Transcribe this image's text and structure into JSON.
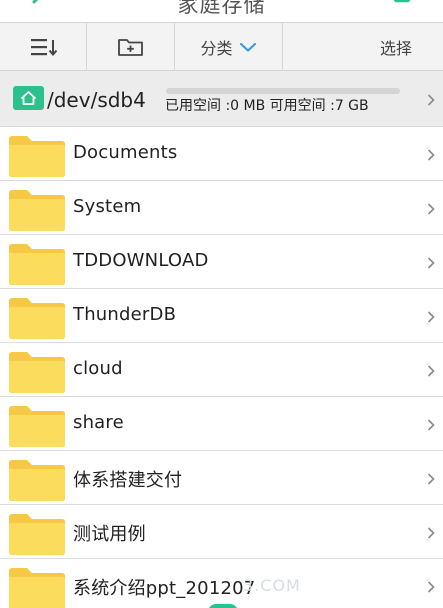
{
  "header": {
    "title": "家庭存储",
    "back_icon": "back-arrow-icon",
    "settings_icon": "settings-gear-icon",
    "accent": "#2cc08d"
  },
  "toolbar": {
    "sort_icon": "sort-list-icon",
    "new_folder_icon": "new-folder-icon",
    "category_label": "分类",
    "select_label": "选择"
  },
  "storage": {
    "path": "/dev/sdb4",
    "usage": "已用空间 :0 MB 可用空间 :7 GB",
    "used_fraction": 0,
    "icon": "home-icon"
  },
  "files": [
    {
      "name": "Documents"
    },
    {
      "name": "System"
    },
    {
      "name": "TDDOWNLOAD"
    },
    {
      "name": "ThunderDB"
    },
    {
      "name": "cloud"
    },
    {
      "name": "share"
    },
    {
      "name": "体系搭建交付"
    },
    {
      "name": "测试用例"
    },
    {
      "name": "系统介绍ppt_201207"
    }
  ],
  "watermark": "3.COM"
}
